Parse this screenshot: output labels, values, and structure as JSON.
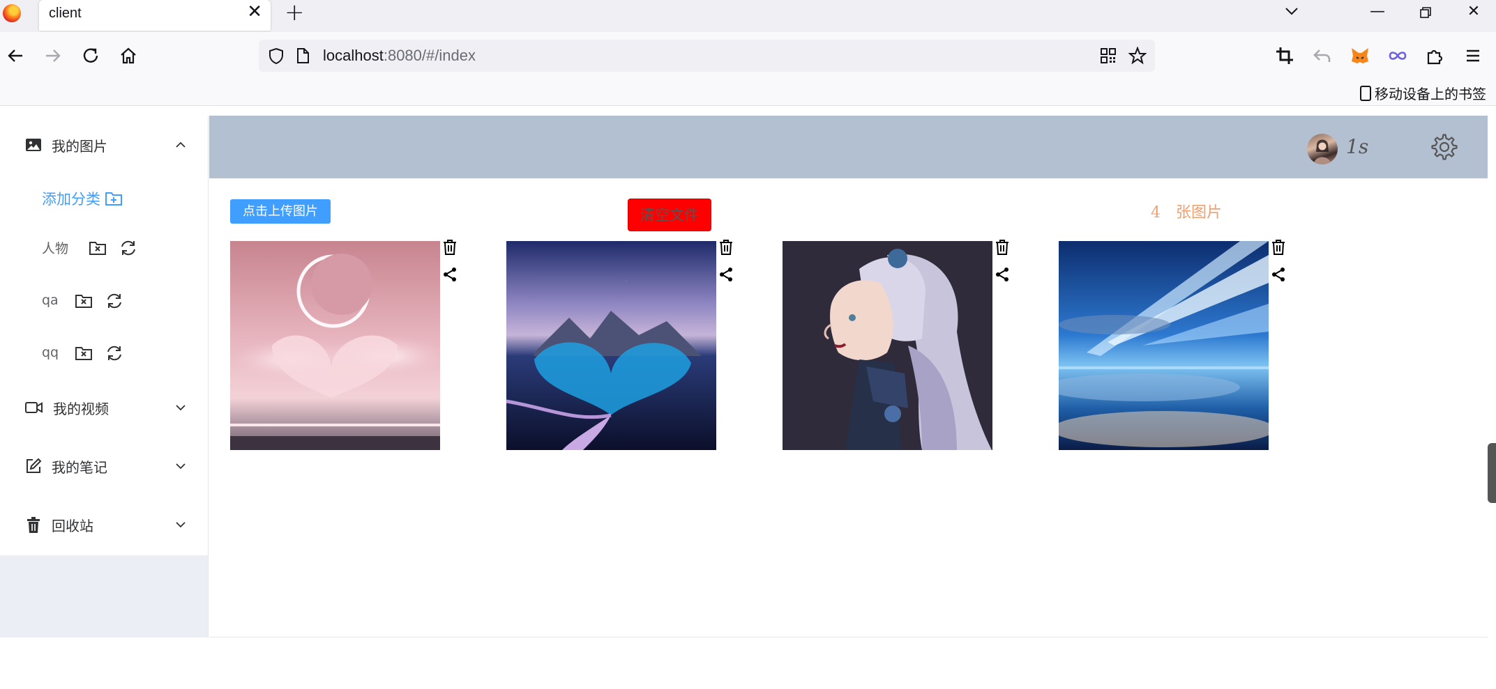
{
  "browser": {
    "tab_title": "client",
    "url_host": "localhost",
    "url_rest": ":8080/#/index",
    "mobile_bookmarks": "移动设备上的书签"
  },
  "sidebar": {
    "pictures_label": "我的图片",
    "add_category": "添加分类",
    "categories": [
      {
        "name": "人物"
      },
      {
        "name": "qa"
      },
      {
        "name": "qq"
      }
    ],
    "videos_label": "我的视频",
    "notes_label": "我的笔记",
    "recycle_label": "回收站"
  },
  "header": {
    "username": "1s"
  },
  "main": {
    "upload_label": "点击上传图片",
    "clear_label": "清空文件",
    "count_number": "4",
    "count_suffix": "张图片"
  },
  "images": [
    {
      "name": "pink-moon-heart-clouds"
    },
    {
      "name": "night-heart-lake-moon"
    },
    {
      "name": "silver-haired-girl-profile"
    },
    {
      "name": "blue-light-beams-sky"
    }
  ],
  "colors": {
    "primary": "#409eff",
    "danger": "#ff0000",
    "header_bg": "#b3c0d1",
    "count_text": "#f0a070"
  }
}
